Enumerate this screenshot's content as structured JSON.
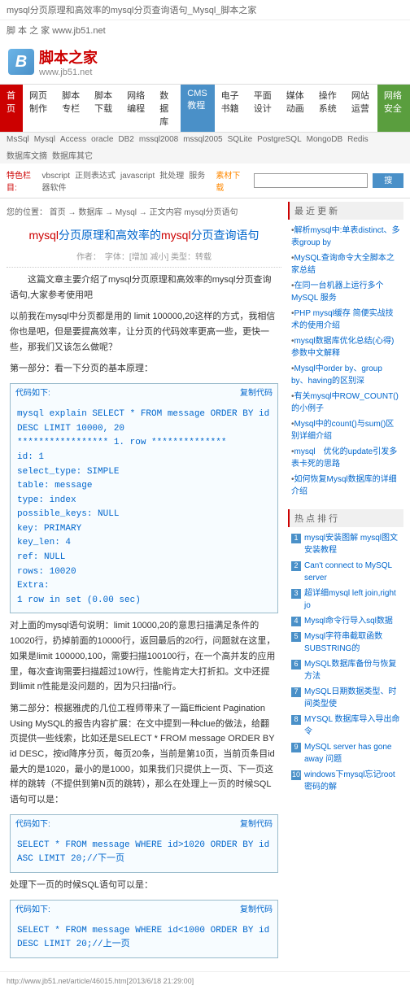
{
  "page_title": "mysql分页原理和高效率的mysql分页查询语句_Mysql_脚本之家",
  "site_text": "脚 本 之 家 www.jb51.net",
  "logo": {
    "letter": "B",
    "cn": "脚本之家",
    "en": "www.jb51.net"
  },
  "nav_main": [
    {
      "label": "首页",
      "cls": "active"
    },
    {
      "label": "网页制作"
    },
    {
      "label": "脚本专栏"
    },
    {
      "label": "脚本下载"
    },
    {
      "label": "网络编程"
    },
    {
      "label": "数据库"
    },
    {
      "label": "CMS教程",
      "cls": "blue"
    },
    {
      "label": "电子书籍"
    },
    {
      "label": "平面设计"
    },
    {
      "label": "媒体动画"
    },
    {
      "label": "操作系统"
    },
    {
      "label": "网站运营"
    },
    {
      "label": "网络安全",
      "cls": "green"
    }
  ],
  "nav_sub": [
    "MsSql",
    "Mysql",
    "Access",
    "oracle",
    "DB2",
    "mssql2008",
    "mssql2005",
    "SQLite",
    "PostgreSQL",
    "MongoDB",
    "Redis",
    "数据库文摘",
    "数据库其它"
  ],
  "search_row": {
    "hot": "特色栏目:",
    "items": [
      "vbscript",
      "正则表达式",
      "javascript",
      "批处理",
      "服务器软件"
    ],
    "dl": "素材下载",
    "btn": "搜索"
  },
  "breadcrumb": {
    "pre": "您的位置：",
    "items": [
      "首页",
      "数据库",
      "Mysql",
      "正文内容"
    ],
    "cur": "mysql分页语句"
  },
  "article": {
    "title_a": "mysql",
    "title_b": "分页原理和高效率的",
    "title_c": "mysql",
    "title_d": "分页查询语句",
    "meta": "作者：　字体：[增加 减小] 类型：转载",
    "intro": "这篇文章主要介绍了mysql分页原理和高效率的mysql分页查询语句,大家参考使用吧",
    "p1_a": "以前我在mysql中分页都是用的 limit 100000,20这样的方式，我相信你也是吧，但是要提高效率，让分页的代码效率更高一些，更快一些，那我们又该怎么做呢？",
    "p2": "第一部分：看一下分页的基本原理：",
    "code1_label": "代码如下:",
    "code1_copy": "复制代码",
    "code1_lines": [
      "mysql explain SELECT * FROM message ORDER BY id DESC LIMIT 10000, 20",
      "***************** 1. row **************",
      "id: 1",
      "select_type: SIMPLE",
      "table: message",
      "type: index",
      "possible_keys: NULL",
      "key: PRIMARY",
      "key_len: 4",
      "ref: NULL",
      "rows: 10020",
      "Extra:",
      "1 row in set (0.00 sec)"
    ],
    "p3": "对上面的mysql语句说明：limit 10000,20的意思扫描满足条件的10020行，扔掉前面的10000行，返回最后的20行，问题就在这里，如果是limit 100000,100，需要扫描100100行，在一个高并发的应用里，每次查询需要扫描超过10W行，性能肯定大打折扣。文中还提到limit n性能是没问题的，因为只扫描n行。",
    "p4": "第二部分：根据雅虎的几位工程师带来了一篇Efficient Pagination Using MySQL的报告内容扩展：在文中提到一种clue的做法，给翻页提供一些线索，比如还是SELECT * FROM message ORDER BY id DESC，按id降序分页，每页20条，当前是第10页，当前页条目id最大的是1020，最小的是1000，如果我们只提供上一页、下一页这样的跳转（不提供到第N页的跳转），那么在处理上一页的时候SQL语句可以是：",
    "code2_label": "代码如下:",
    "code2_copy": "复制代码",
    "code2": "SELECT * FROM message WHERE id>1020 ORDER BY id ASC LIMIT 20;//下一页",
    "p5": "处理下一页的时候SQL语句可以是：",
    "code3_label": "代码如下:",
    "code3_copy": "复制代码",
    "code3": "SELECT * FROM message WHERE id<1000 ORDER BY id DESC LIMIT 20;//上一页"
  },
  "side_latest_title": "最 近 更 新",
  "side_latest": [
    "解析mysql中:单表distinct、多表group by",
    "MySQL查询命令大全脚本之家总结",
    "在同一台机器上运行多个 MySQL 服务",
    "PHP mysql缓存 简便实战技术的使用介绍",
    "mysql数据库优化总结(心得)参数中文解释",
    "Mysql中order by、group by、having的区别深",
    "有关mysql中ROW_COUNT()的小例子",
    "Mysql中的count()与sum()区别详细介绍",
    "mysql　优化的update引发多表卡死的思路",
    "如何恢复Mysql数据库的详细介绍"
  ],
  "side_hot_title": "热 点 排 行",
  "side_hot": [
    "mysql安装图解 mysql图文安装教程",
    "Can't connect to MySQL server",
    "超详细mysql left join,right jo",
    "Mysql命令行导入sql数据",
    "Mysql字符串截取函数SUBSTRING的",
    "MySQL数据库备份与恢复方法",
    "MySQL日期数据类型、时间类型使",
    "MYSQL 数据库导入导出命令",
    "MySQL server has gone away 问题",
    "windows下mysql忘记root密码的解"
  ],
  "footer": "http://www.jb51.net/article/46015.htm[2013/6/18 21:29:00]"
}
